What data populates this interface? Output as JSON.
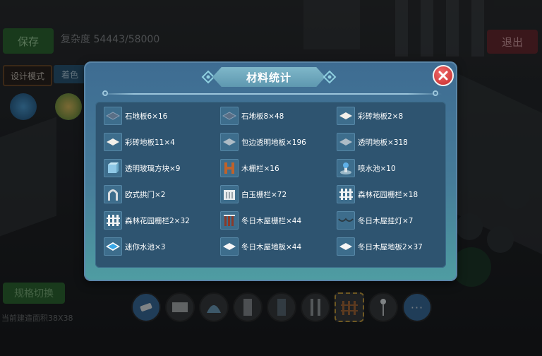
{
  "hud": {
    "save_label": "保存",
    "complexity": "复杂度 54443/58000",
    "exit_label": "退出",
    "mode_label": "设计模式",
    "mode2_label": "着色",
    "spec_button": "规格切换",
    "spec_text": "当前建造面积38X38"
  },
  "dialog": {
    "title": "材料统计",
    "items": [
      {
        "label": "石地板6×16",
        "icon": "stone-floor-icon"
      },
      {
        "label": "石地板8×48",
        "icon": "stone-floor-icon"
      },
      {
        "label": "彩砖地板2×8",
        "icon": "tile-floor-icon"
      },
      {
        "label": "彩砖地板11×4",
        "icon": "tile-floor-icon"
      },
      {
        "label": "包边透明地板×196",
        "icon": "glass-floor-icon"
      },
      {
        "label": "透明地板×318",
        "icon": "glass-floor-icon"
      },
      {
        "label": "透明玻璃方块×9",
        "icon": "glass-block-icon"
      },
      {
        "label": "木栅栏×16",
        "icon": "wood-fence-icon"
      },
      {
        "label": "喷水池×10",
        "icon": "fountain-icon"
      },
      {
        "label": "欧式拱门×2",
        "icon": "arch-icon"
      },
      {
        "label": "白玉栅栏×72",
        "icon": "jade-fence-icon"
      },
      {
        "label": "森林花园栅栏×18",
        "icon": "garden-fence-icon"
      },
      {
        "label": "森林花园栅栏2×32",
        "icon": "garden-fence-icon"
      },
      {
        "label": "冬日木屋栅栏×44",
        "icon": "cabin-fence-icon"
      },
      {
        "label": "冬日木屋挂灯×7",
        "icon": "string-lights-icon"
      },
      {
        "label": "迷你水池×3",
        "icon": "mini-pool-icon"
      },
      {
        "label": "冬日木屋地板×44",
        "icon": "cabin-floor-icon"
      },
      {
        "label": "冬日木屋地板2×37",
        "icon": "cabin-floor-icon"
      }
    ]
  },
  "hotbar": {
    "more_label": "···"
  },
  "colors": {
    "dialog_top": "#3e6c92",
    "dialog_bottom": "#4f9da2",
    "panel": "#2e5470",
    "close_red": "#c42a2a"
  }
}
